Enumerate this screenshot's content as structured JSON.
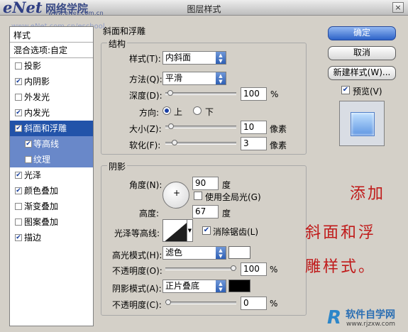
{
  "window": {
    "title": "图层样式",
    "close_label": "×"
  },
  "watermark": {
    "logo": "eNet",
    "cn": "网络学院",
    "url": "www.eNet.com.cn",
    "url2": "www.eNet.com.cn/eschool"
  },
  "left_panel": {
    "header": "样式",
    "blend_options": "混合选项:自定",
    "items": [
      {
        "label": "投影",
        "checked": false
      },
      {
        "label": "内阴影",
        "checked": true
      },
      {
        "label": "外发光",
        "checked": false
      },
      {
        "label": "内发光",
        "checked": true
      },
      {
        "label": "斜面和浮雕",
        "checked": true,
        "selected": true
      },
      {
        "label": "等高线",
        "checked": true,
        "sub": true
      },
      {
        "label": "纹理",
        "checked": false,
        "sub": true
      },
      {
        "label": "光泽",
        "checked": true
      },
      {
        "label": "颜色叠加",
        "checked": true
      },
      {
        "label": "渐变叠加",
        "checked": false
      },
      {
        "label": "图案叠加",
        "checked": false
      },
      {
        "label": "描边",
        "checked": true
      }
    ],
    "check_mark": "✔"
  },
  "bevel": {
    "section_title": "斜面和浮雕",
    "structure_title": "结构",
    "style_label": "样式(T):",
    "style_value": "内斜面",
    "technique_label": "方法(Q):",
    "technique_value": "平滑",
    "depth_label": "深度(D):",
    "depth_value": "100",
    "depth_unit": "%",
    "depth_level": 0.03,
    "direction_label": "方向:",
    "dir_up": "上",
    "dir_down": "下",
    "size_label": "大小(Z):",
    "size_value": "10",
    "size_unit": "像素",
    "size_level": 0.04,
    "soften_label": "软化(F):",
    "soften_value": "3",
    "soften_unit": "像素",
    "soften_level": 0.1
  },
  "shading": {
    "title": "阴影",
    "angle_label": "角度(N):",
    "angle_value": "90",
    "angle_unit": "度",
    "global_light": "使用全局光(G)",
    "altitude_label": "高度:",
    "altitude_value": "67",
    "altitude_unit": "度",
    "gloss_label": "光泽等高线:",
    "anti_alias": "消除锯齿(L)",
    "highlight_label": "高光模式(H):",
    "highlight_value": "滤色",
    "highlight_color": "#ffffff",
    "opacity1_label": "不透明度(O):",
    "opacity1_value": "100",
    "opacity1_level": 1.0,
    "shadow_label": "阴影模式(A):",
    "shadow_value": "正片叠底",
    "shadow_color": "#000000",
    "opacity2_label": "不透明度(C):",
    "opacity2_value": "0",
    "opacity2_level": 0.0,
    "percent": "%",
    "dial_center": "+"
  },
  "buttons": {
    "ok": "确定",
    "cancel": "取消",
    "new_style": "新建样式(W)...",
    "preview": "预览(V)"
  },
  "annotation": {
    "line1": "添加",
    "line2": "斜面和浮",
    "line3": "雕样式。"
  },
  "site_logo": {
    "mark": "R",
    "text": "软件自学网",
    "url": "www.rjzxw.com"
  }
}
